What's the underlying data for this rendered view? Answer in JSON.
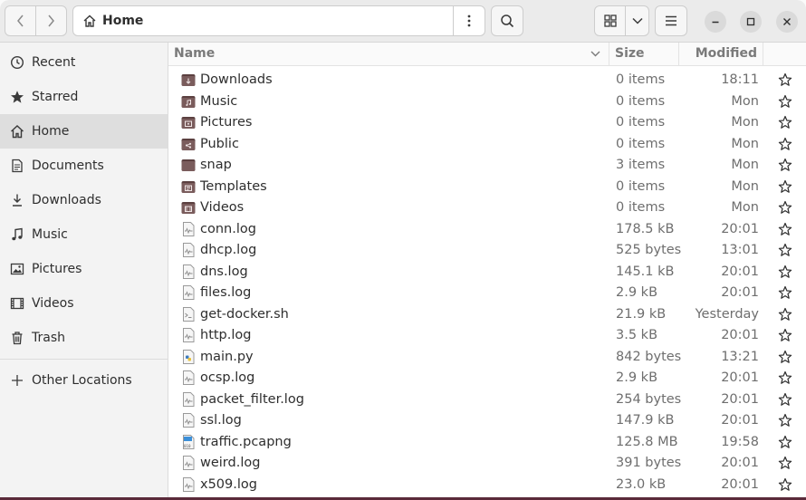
{
  "window": {
    "title": "Home"
  },
  "pathbar": {
    "current_location": "Home",
    "location_icon": "home-icon"
  },
  "toolbar": {
    "back_icon": "chevron-left-icon",
    "forward_icon": "chevron-right-icon",
    "path_menu_icon": "vertical-dots-icon",
    "search_icon": "search-icon",
    "view_icon": "grid-view-icon",
    "view_options_icon": "chevron-down-icon",
    "main_menu_icon": "hamburger-menu-icon",
    "minimize_icon": "minimize-icon",
    "maximize_icon": "maximize-icon",
    "close_icon": "close-icon"
  },
  "sidebar": {
    "items": [
      {
        "label": "Recent",
        "icon": "clock-icon"
      },
      {
        "label": "Starred",
        "icon": "star-icon"
      },
      {
        "label": "Home",
        "icon": "home-icon",
        "active": true
      },
      {
        "label": "Documents",
        "icon": "document-icon"
      },
      {
        "label": "Downloads",
        "icon": "download-icon"
      },
      {
        "label": "Music",
        "icon": "music-icon"
      },
      {
        "label": "Pictures",
        "icon": "picture-icon"
      },
      {
        "label": "Videos",
        "icon": "video-icon"
      },
      {
        "label": "Trash",
        "icon": "trash-icon"
      }
    ],
    "other_locations": {
      "label": "Other Locations",
      "icon": "plus-icon"
    }
  },
  "columns": {
    "name": "Name",
    "size": "Size",
    "modified": "Modified",
    "sort_icon": "chevron-down-icon"
  },
  "files": [
    {
      "name": "Downloads",
      "size": "0 items",
      "modified": "18:11",
      "icon": "folder-download-icon"
    },
    {
      "name": "Music",
      "size": "0 items",
      "modified": "Mon",
      "icon": "folder-music-icon"
    },
    {
      "name": "Pictures",
      "size": "0 items",
      "modified": "Mon",
      "icon": "folder-pictures-icon"
    },
    {
      "name": "Public",
      "size": "0 items",
      "modified": "Mon",
      "icon": "folder-public-icon"
    },
    {
      "name": "snap",
      "size": "3 items",
      "modified": "Mon",
      "icon": "folder-icon"
    },
    {
      "name": "Templates",
      "size": "0 items",
      "modified": "Mon",
      "icon": "folder-templates-icon"
    },
    {
      "name": "Videos",
      "size": "0 items",
      "modified": "Mon",
      "icon": "folder-videos-icon"
    },
    {
      "name": "conn.log",
      "size": "178.5 kB",
      "modified": "20:01",
      "icon": "log-file-icon"
    },
    {
      "name": "dhcp.log",
      "size": "525 bytes",
      "modified": "13:01",
      "icon": "log-file-icon"
    },
    {
      "name": "dns.log",
      "size": "145.1 kB",
      "modified": "20:01",
      "icon": "log-file-icon"
    },
    {
      "name": "files.log",
      "size": "2.9 kB",
      "modified": "20:01",
      "icon": "log-file-icon"
    },
    {
      "name": "get-docker.sh",
      "size": "21.9 kB",
      "modified": "Yesterday",
      "icon": "script-file-icon"
    },
    {
      "name": "http.log",
      "size": "3.5 kB",
      "modified": "20:01",
      "icon": "log-file-icon"
    },
    {
      "name": "main.py",
      "size": "842 bytes",
      "modified": "13:21",
      "icon": "python-file-icon"
    },
    {
      "name": "ocsp.log",
      "size": "2.9 kB",
      "modified": "20:01",
      "icon": "log-file-icon"
    },
    {
      "name": "packet_filter.log",
      "size": "254 bytes",
      "modified": "20:01",
      "icon": "log-file-icon"
    },
    {
      "name": "ssl.log",
      "size": "147.9 kB",
      "modified": "20:01",
      "icon": "log-file-icon"
    },
    {
      "name": "traffic.pcapng",
      "size": "125.8 MB",
      "modified": "19:58",
      "icon": "binary-file-icon"
    },
    {
      "name": "weird.log",
      "size": "391 bytes",
      "modified": "20:01",
      "icon": "log-file-icon"
    },
    {
      "name": "x509.log",
      "size": "23.0 kB",
      "modified": "20:01",
      "icon": "log-file-icon"
    }
  ],
  "colors": {
    "folder": "#7a5c5c",
    "folder_dark": "#5b4040",
    "accent": "#e95420"
  }
}
